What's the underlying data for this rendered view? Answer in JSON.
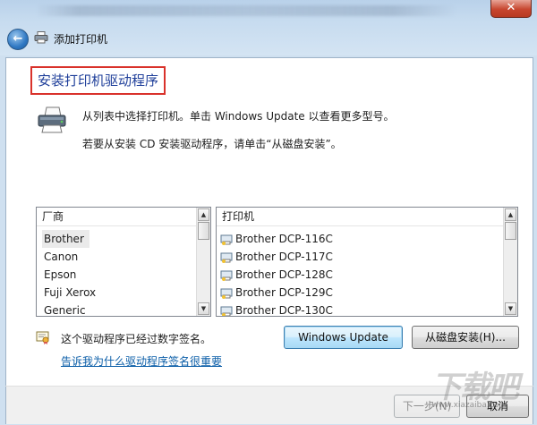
{
  "window": {
    "close_symbol": "✕",
    "back_symbol": "←",
    "title": "添加打印机"
  },
  "page": {
    "heading": "安装打印机驱动程序",
    "info_line1": "从列表中选择打印机。单击 Windows Update 以查看更多型号。",
    "info_line2": "若要从安装 CD 安装驱动程序，请单击“从磁盘安装”。"
  },
  "manufacturers": {
    "header": "厂商",
    "items": [
      "Brother",
      "Canon",
      "Epson",
      "Fuji Xerox",
      "Generic"
    ],
    "selected": "Brother"
  },
  "printers": {
    "header": "打印机",
    "items": [
      "Brother DCP-116C",
      "Brother DCP-117C",
      "Brother DCP-128C",
      "Brother DCP-129C",
      "Brother DCP-130C"
    ]
  },
  "scroll": {
    "up": "▲",
    "down": "▼"
  },
  "signature": {
    "text": "这个驱动程序已经过数字签名。",
    "link": "告诉我为什么驱动程序签名很重要"
  },
  "buttons": {
    "windows_update": "Windows Update",
    "have_disk": "从磁盘安装(H)...",
    "next": "下一步(N)",
    "cancel": "取消"
  },
  "watermark": {
    "text": "下载吧",
    "sub": "www.xiazaiba.com"
  },
  "colors": {
    "heading_border": "#d9322b",
    "heading_text": "#1f3f9a",
    "link": "#0b5ea8"
  },
  "icons": [
    "back-arrow-icon",
    "printer-icon",
    "close-icon",
    "certificate-icon",
    "scroll-up-icon",
    "scroll-down-icon"
  ]
}
